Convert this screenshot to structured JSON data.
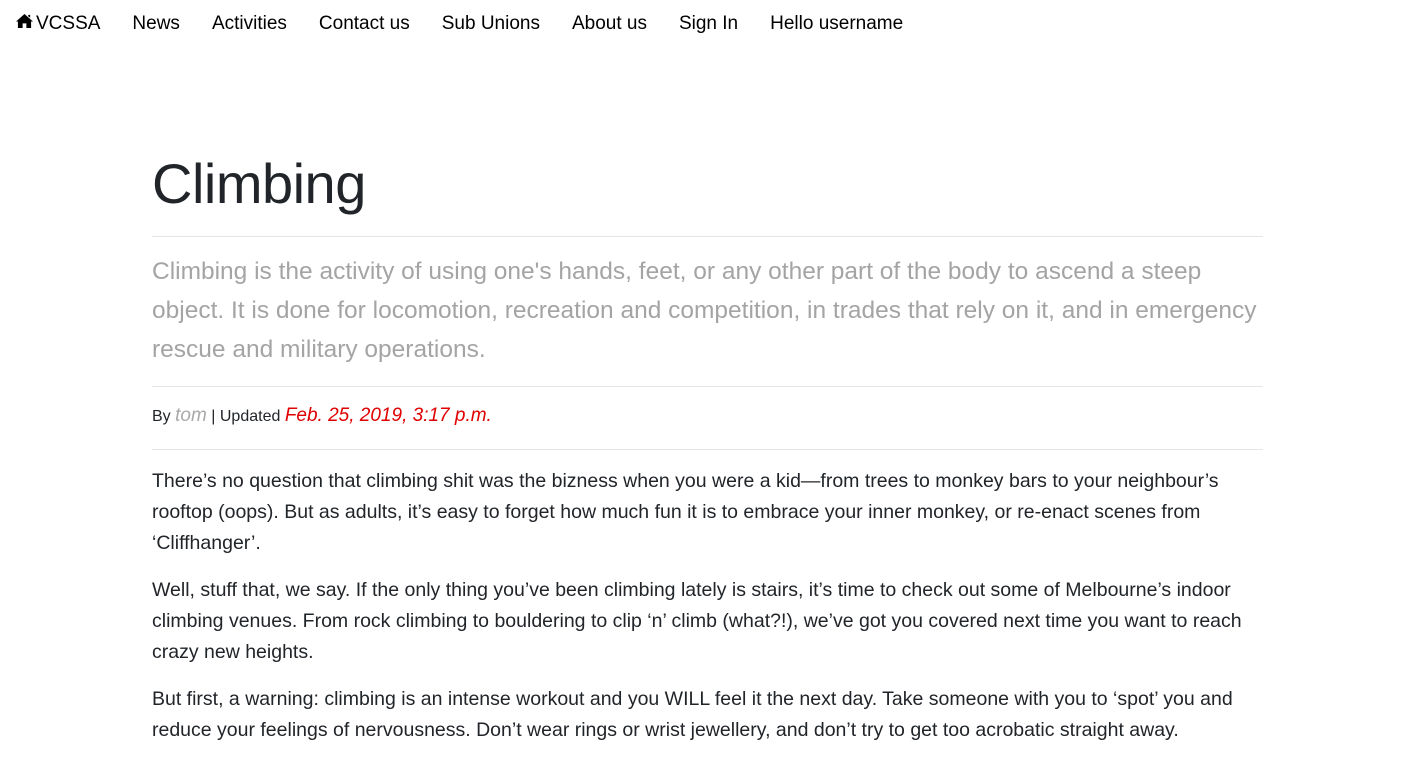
{
  "nav": {
    "brand": "VCSSA",
    "brand_icon": "home-icon",
    "items": [
      {
        "label": "News"
      },
      {
        "label": "Activities"
      },
      {
        "label": "Contact us"
      },
      {
        "label": "Sub Unions"
      },
      {
        "label": "About us"
      },
      {
        "label": "Sign In"
      },
      {
        "label": "Hello username"
      }
    ]
  },
  "article": {
    "title": "Climbing",
    "lead": "Climbing is the activity of using one's hands, feet, or any other part of the body to ascend a steep object. It is done for locomotion, recreation and competition, in trades that rely on it, and in emergency rescue and military operations.",
    "byline": {
      "by_label": "By",
      "author": "tom",
      "separator": "| Updated",
      "date": "Feb. 25, 2019, 3:17 p.m."
    },
    "paragraphs": [
      "There’s no question that climbing shit was the bizness when you were a kid—from trees to monkey bars to your neighbour’s rooftop (oops). But as adults, it’s easy to forget how much fun it is to embrace your inner monkey, or re-enact scenes from ‘Cliffhanger’.",
      "Well, stuff that, we say. If the only thing you’ve been climbing lately is stairs, it’s time to check out some of Melbourne’s indoor climbing venues. From rock climbing to bouldering to clip ‘n’ climb (what?!), we’ve got you covered next time you want to reach crazy new heights.",
      "But first, a warning: climbing is an intense workout and you WILL feel it the next day. Take someone with you to ‘spot’ you and reduce your feelings of nervousness. Don’t wear rings or wrist jewellery, and don’t try to get too acrobatic straight away."
    ]
  },
  "colors": {
    "lead_text": "#a4a4a4",
    "author": "#a9a9a9",
    "date": "#e00000"
  }
}
